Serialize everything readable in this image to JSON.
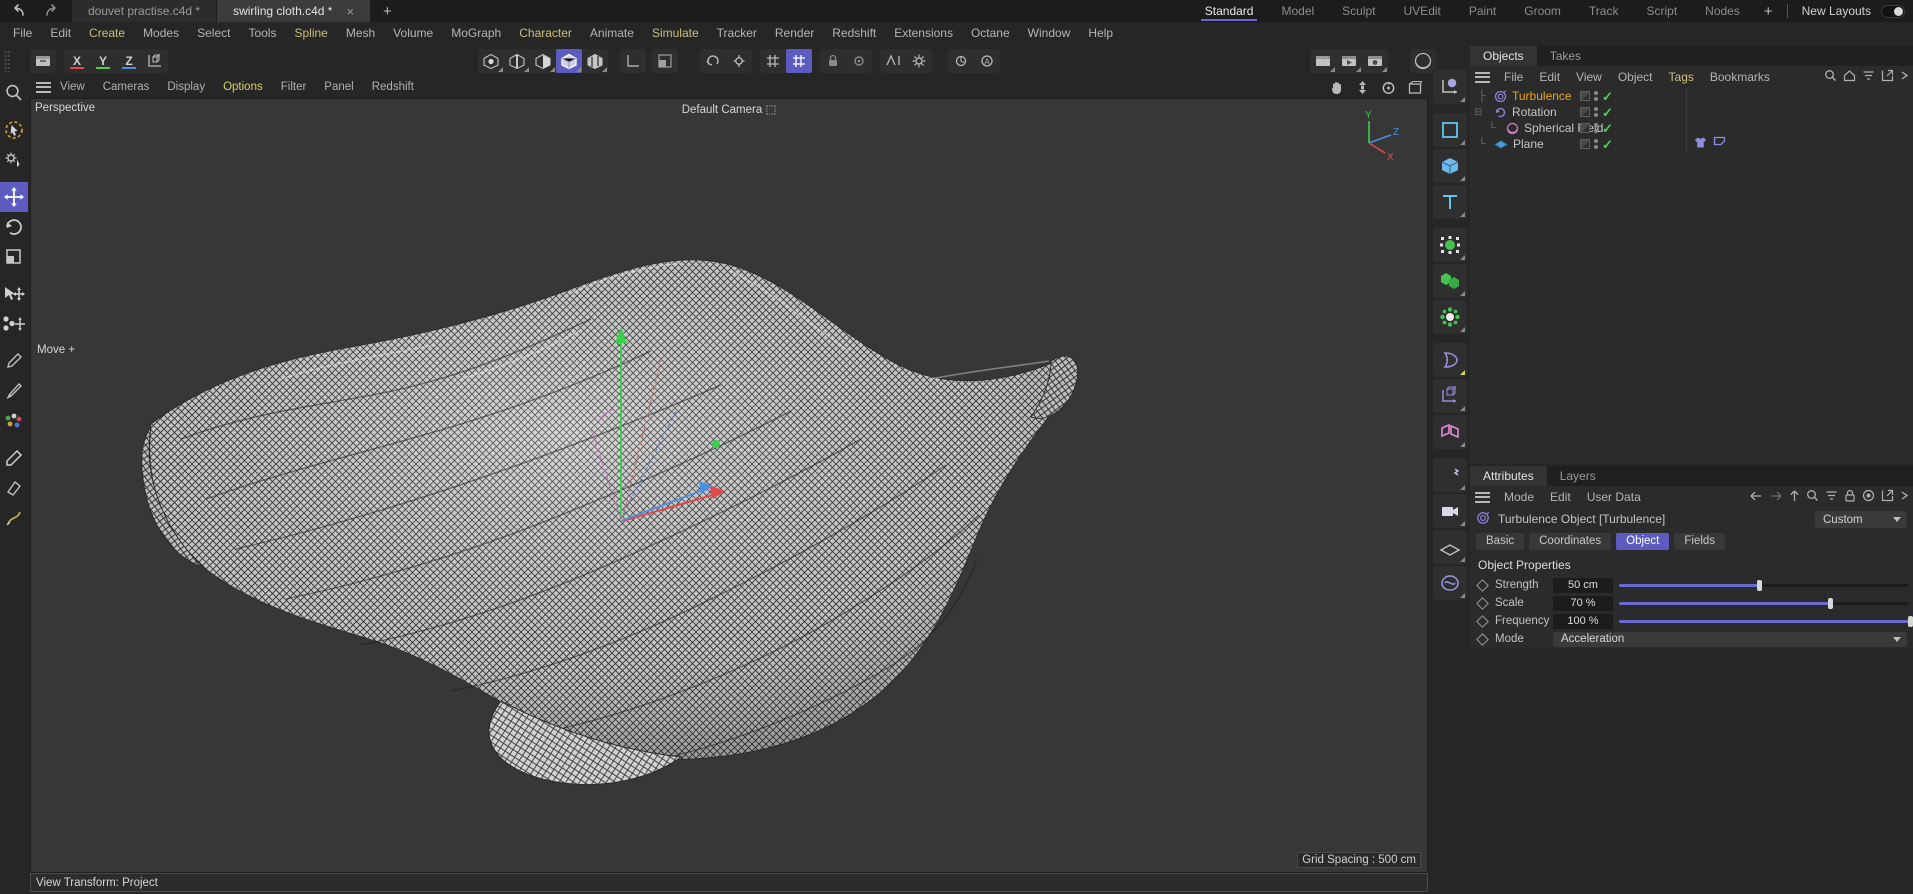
{
  "topbar": {
    "undo_icon": "undo-arrow-icon",
    "redo_icon": "redo-arrow-icon",
    "tabs": [
      {
        "label": "douvet practise.c4d *",
        "active": false,
        "closable": false
      },
      {
        "label": "swirling cloth.c4d *",
        "active": true,
        "closable": true
      }
    ],
    "close_glyph": "×",
    "add_tab_glyph": "+",
    "layouts": [
      "Standard",
      "Model",
      "Sculpt",
      "UVEdit",
      "Paint",
      "Groom",
      "Track",
      "Script",
      "Nodes"
    ],
    "active_layout": "Standard",
    "layout_add_glyph": "+",
    "new_layouts_label": "New Layouts",
    "accent_color": "#6a6ad0"
  },
  "menubar": {
    "items": [
      {
        "label": "File",
        "highlight": false
      },
      {
        "label": "Edit",
        "highlight": false
      },
      {
        "label": "Create",
        "highlight": true
      },
      {
        "label": "Modes",
        "highlight": false
      },
      {
        "label": "Select",
        "highlight": false
      },
      {
        "label": "Tools",
        "highlight": false
      },
      {
        "label": "Spline",
        "highlight": true
      },
      {
        "label": "Mesh",
        "highlight": false
      },
      {
        "label": "Volume",
        "highlight": false
      },
      {
        "label": "MoGraph",
        "highlight": false
      },
      {
        "label": "Character",
        "highlight": true
      },
      {
        "label": "Animate",
        "highlight": false
      },
      {
        "label": "Simulate",
        "highlight": true
      },
      {
        "label": "Tracker",
        "highlight": false
      },
      {
        "label": "Render",
        "highlight": false
      },
      {
        "label": "Redshift",
        "highlight": false
      },
      {
        "label": "Extensions",
        "highlight": false
      },
      {
        "label": "Octane",
        "highlight": false
      },
      {
        "label": "Window",
        "highlight": false
      },
      {
        "label": "Help",
        "highlight": false
      }
    ]
  },
  "toolbar": {
    "content_browser_icon": "content-browser-icon",
    "axis_x_label": "X",
    "axis_y_label": "Y",
    "axis_z_label": "Z",
    "axis_x_color": "#e04a4a",
    "axis_y_color": "#4ccf56",
    "axis_z_color": "#4a8fe0",
    "world_axis_icon": "world-object-axis-icon",
    "mode_icons": [
      "point-mode-icon",
      "edge-mode-icon",
      "polygon-mode-icon",
      "model-mode-icon",
      "texture-mode-icon"
    ],
    "active_mode": "model-mode-icon",
    "axis_tool_icon": "axis-tool-icon",
    "workplane_icon": "workplane-icon",
    "enable_axis_icon": "enable-axis-icon",
    "enable_snap_icon": "enable-snap-icon",
    "grid_snap_icons": [
      "grid-snap-icon",
      "quantize-snap-icon"
    ],
    "locked_icons": [
      "lock-icon",
      "unlock-icon"
    ],
    "extra_icons": [
      "render-settings-icon",
      "render-region-icon",
      "render-picture-viewer-icon",
      "layout-icon"
    ],
    "render_icons": [
      "render-view-icon",
      "render-region-view-icon",
      "render-settings-gear-icon"
    ],
    "material_sphere_icon": "material-preview-icon"
  },
  "left_toolbar": {
    "items": [
      {
        "icon": "magnifier-icon",
        "active": false
      },
      {
        "icon": "live-selection-icon",
        "active": false
      },
      {
        "icon": "tool-settings-icon",
        "active": false
      },
      {
        "icon": "move-tool-icon",
        "active": true
      },
      {
        "icon": "rotate-tool-icon",
        "active": false
      },
      {
        "icon": "scale-tool-icon",
        "active": false
      },
      {
        "icon": "move-object-icon",
        "active": false
      },
      {
        "icon": "snap-move-icon",
        "active": false
      },
      {
        "icon": "brush-icon",
        "active": false
      },
      {
        "icon": "knife-icon",
        "active": false
      },
      {
        "icon": "paint-dots-icon",
        "active": false
      },
      {
        "icon": "pen-icon",
        "active": false
      },
      {
        "icon": "eraser-icon",
        "active": false
      },
      {
        "icon": "sculpt-icon",
        "active": false
      }
    ]
  },
  "viewport": {
    "menu": [
      {
        "label": "View",
        "highlight": false
      },
      {
        "label": "Cameras",
        "highlight": false
      },
      {
        "label": "Display",
        "highlight": false
      },
      {
        "label": "Options",
        "highlight": true
      },
      {
        "label": "Filter",
        "highlight": false
      },
      {
        "label": "Panel",
        "highlight": false
      },
      {
        "label": "Redshift",
        "highlight": false
      }
    ],
    "nav_icons": [
      "pan-hand-icon",
      "dolly-icon",
      "orbit-icon",
      "maximize-viewport-icon"
    ],
    "label": "Perspective",
    "camera_label": "Default Camera",
    "camera_icon": "camera-lock-icon",
    "tool_hint": "Move",
    "tool_hint_glyph": "+",
    "grid_spacing": "Grid Spacing : 500 cm",
    "status": "View Transform: Project",
    "axis_gizmo": {
      "x": "X",
      "y": "Y",
      "z": "Z"
    },
    "background_color": "#373737",
    "mesh_description": "wireframe cloth plane simulation"
  },
  "right_rail": {
    "items": [
      {
        "icon": "null-object-icon",
        "corner": true,
        "corner_color": "gray"
      },
      {
        "icon": "spline-rectangle-icon",
        "corner": true,
        "corner_color": "gray"
      },
      {
        "icon": "cube-primitive-icon",
        "corner": true,
        "corner_color": "gray"
      },
      {
        "icon": "text-spline-icon",
        "corner": true,
        "corner_color": "gray"
      },
      {
        "icon": "subdivision-surface-icon",
        "corner": true,
        "corner_color": "gray"
      },
      {
        "icon": "array-clone-icon",
        "corner": true,
        "corner_color": "gray"
      },
      {
        "icon": "mograph-effector-icon",
        "corner": true,
        "corner_color": "gray"
      },
      {
        "icon": "bend-deformer-icon",
        "corner": true,
        "corner_color": "yellow"
      },
      {
        "icon": "scene-axis-icon",
        "corner": true,
        "corner_color": "gray"
      },
      {
        "icon": "field-object-icon",
        "corner": true,
        "corner_color": "gray"
      },
      {
        "icon": "light-object-icon",
        "corner": true,
        "corner_color": "gray"
      },
      {
        "icon": "camera-object-icon",
        "corner": true,
        "corner_color": "gray"
      },
      {
        "icon": "floor-object-icon",
        "corner": true,
        "corner_color": "gray"
      },
      {
        "icon": "simulation-icon",
        "corner": true,
        "corner_color": "gray"
      }
    ]
  },
  "objects_panel": {
    "tabs": [
      {
        "label": "Objects",
        "active": true
      },
      {
        "label": "Takes",
        "active": false
      }
    ],
    "menu": [
      {
        "label": "File",
        "highlight": false
      },
      {
        "label": "Edit",
        "highlight": false
      },
      {
        "label": "View",
        "highlight": false
      },
      {
        "label": "Object",
        "highlight": false
      },
      {
        "label": "Tags",
        "highlight": true
      },
      {
        "label": "Bookmarks",
        "highlight": false
      }
    ],
    "menu_icons": [
      "search-icon",
      "home-icon",
      "filter-icon",
      "external-link-icon",
      "expand-icon"
    ],
    "tree": [
      {
        "name": "Turbulence",
        "icon": "turbulence-field-icon",
        "icon_color": "#8e7ed8",
        "indent": 0,
        "selected": true,
        "expandable": false,
        "expanded": false,
        "tags": []
      },
      {
        "name": "Rotation",
        "icon": "rotation-field-icon",
        "icon_color": "#8e7ed8",
        "indent": 0,
        "selected": false,
        "expandable": true,
        "expanded": true,
        "tags": []
      },
      {
        "name": "Spherical Field",
        "icon": "spherical-field-icon",
        "icon_color": "#d07ac8",
        "indent": 1,
        "selected": false,
        "expandable": false,
        "expanded": false,
        "tags": []
      },
      {
        "name": "Plane",
        "icon": "plane-primitive-icon",
        "icon_color": "#4a9fd8",
        "indent": 0,
        "selected": false,
        "expandable": false,
        "expanded": false,
        "tags": [
          "cloth-tag-icon",
          "cloth-belt-tag-icon"
        ]
      }
    ]
  },
  "attributes_panel": {
    "tabs": [
      {
        "label": "Attributes",
        "active": true
      },
      {
        "label": "Layers",
        "active": false
      }
    ],
    "menu": [
      {
        "label": "Mode",
        "highlight": false
      },
      {
        "label": "Edit",
        "highlight": false
      },
      {
        "label": "User Data",
        "highlight": false
      }
    ],
    "menu_icons": [
      "back-arrow-icon",
      "forward-arrow-icon",
      "up-arrow-icon",
      "search-icon",
      "filter-icon",
      "lock-icon",
      "record-icon",
      "external-link-icon",
      "expand-icon"
    ],
    "object_icon": "turbulence-field-icon",
    "object_title": "Turbulence Object [Turbulence]",
    "mode_selector": "Custom",
    "tabs_row": [
      {
        "label": "Basic",
        "active": false
      },
      {
        "label": "Coordinates",
        "active": false
      },
      {
        "label": "Object",
        "active": true
      },
      {
        "label": "Fields",
        "active": false
      }
    ],
    "section_title": "Object Properties",
    "properties": [
      {
        "label": "Strength",
        "value": "50 cm",
        "type": "slider",
        "percent": 48
      },
      {
        "label": "Scale",
        "value": "70 %",
        "type": "slider",
        "percent": 72
      },
      {
        "label": "Frequency",
        "value": "100 %",
        "type": "slider",
        "percent": 100
      },
      {
        "label": "Mode",
        "value": "Acceleration",
        "type": "dropdown",
        "percent": 0
      }
    ]
  }
}
